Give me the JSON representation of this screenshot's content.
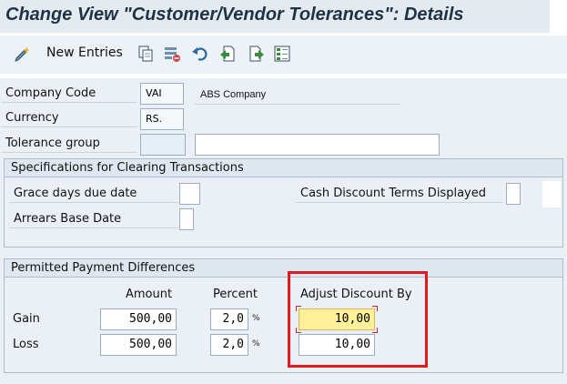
{
  "title": "Change View \"Customer/Vendor Tolerances\": Details",
  "toolbar": {
    "new_entries_label": "New Entries",
    "icons": [
      "new-entries-icon",
      "copy-icon",
      "delete-icon",
      "undo-icon",
      "previous-entry-icon",
      "next-entry-icon",
      "select-all-icon"
    ]
  },
  "header_fields": {
    "company_code": {
      "label": "Company Code",
      "value": "VAI",
      "description": "ABS Company"
    },
    "currency": {
      "label": "Currency",
      "value": "RS."
    },
    "tolerance_group": {
      "label": "Tolerance group",
      "value": "",
      "description": ""
    }
  },
  "clearing": {
    "title": "Specifications for Clearing Transactions",
    "grace_days_label": "Grace days due date",
    "grace_days_value": "",
    "arrears_base_label": "Arrears Base Date",
    "arrears_base_checked": false,
    "cash_discount_label": "Cash Discount Terms Displayed",
    "cash_discount_value": ""
  },
  "payment_diff": {
    "title": "Permitted Payment Differences",
    "columns": {
      "amount": "Amount",
      "percent": "Percent",
      "adjust": "Adjust Discount By"
    },
    "percent_unit": "%",
    "rows": [
      {
        "label": "Gain",
        "amount": "500,00",
        "percent": "2,0",
        "adjust": "10,00"
      },
      {
        "label": "Loss",
        "amount": "500,00",
        "percent": "2,0",
        "adjust": "10,00"
      }
    ]
  },
  "colors": {
    "highlight": "#e3191e",
    "active_field": "#fff19a",
    "background": "#eaf0f5"
  }
}
